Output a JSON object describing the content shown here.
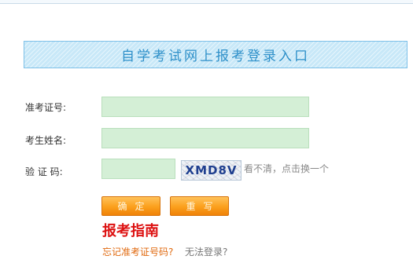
{
  "banner": {
    "title": "自学考试网上报考登录入口"
  },
  "form": {
    "exam_no_label": "准考证号:",
    "exam_no_value": "",
    "name_label": "考生姓名:",
    "name_value": "",
    "captcha_label": "验 证 码:",
    "captcha_value": "",
    "captcha_text": "XMD8V",
    "refresh_text": "看不清，点击换一个"
  },
  "buttons": {
    "confirm_label": "确定",
    "reset_label": "重写"
  },
  "links": {
    "guide": "报考指南",
    "forgot": "忘记准考证号码?",
    "cannot_login": "无法登录?"
  },
  "colors": {
    "banner_bg": "#c8e8f8",
    "banner_text": "#2e90c9",
    "field_bg": "#d4efd6",
    "button_orange": "#fb9f1c",
    "guide_red": "#dd1111",
    "forgot_orange": "#e06a10"
  }
}
